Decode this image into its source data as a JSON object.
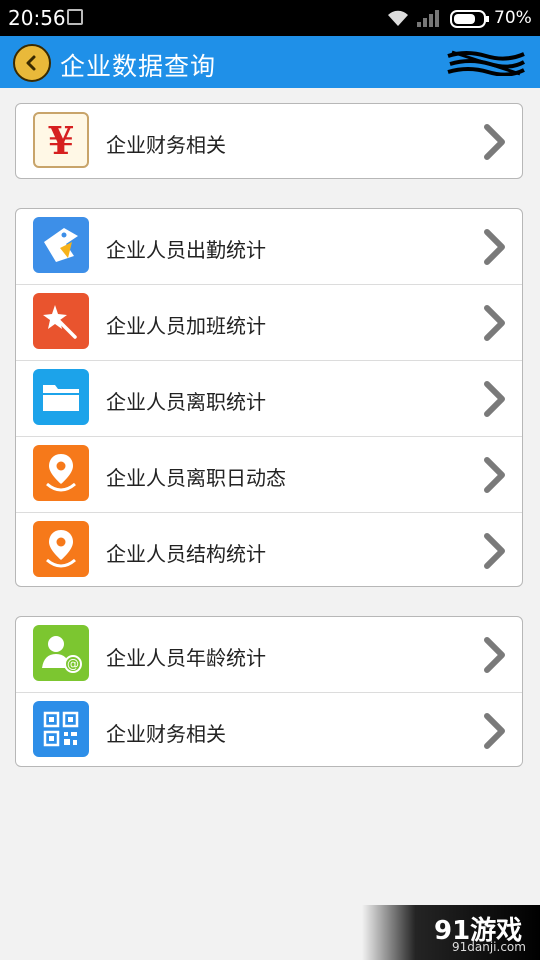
{
  "status_bar": {
    "time": "20:56",
    "battery": "70%"
  },
  "header": {
    "title": "企业数据查询",
    "back_icon": "chevron-left-icon"
  },
  "sections": [
    {
      "items": [
        {
          "label": "企业财务相关",
          "icon": "yen-icon"
        }
      ]
    },
    {
      "items": [
        {
          "label": "企业人员出勤统计",
          "icon": "attendance-icon"
        },
        {
          "label": "企业人员加班统计",
          "icon": "star-wand-icon"
        },
        {
          "label": "企业人员离职统计",
          "icon": "folder-icon"
        },
        {
          "label": "企业人员离职日动态",
          "icon": "location-pin-icon"
        },
        {
          "label": "企业人员结构统计",
          "icon": "location-pin-icon"
        }
      ]
    },
    {
      "items": [
        {
          "label": "企业人员年龄统计",
          "icon": "contact-icon"
        },
        {
          "label": "企业财务相关",
          "icon": "qr-code-icon"
        }
      ]
    }
  ],
  "watermark": {
    "brand": "91游戏",
    "site": "91danji.com"
  },
  "colors": {
    "title_bar": "#1f90e8",
    "back_button": "#e9b93a",
    "chevron": "#7a7a7a"
  }
}
